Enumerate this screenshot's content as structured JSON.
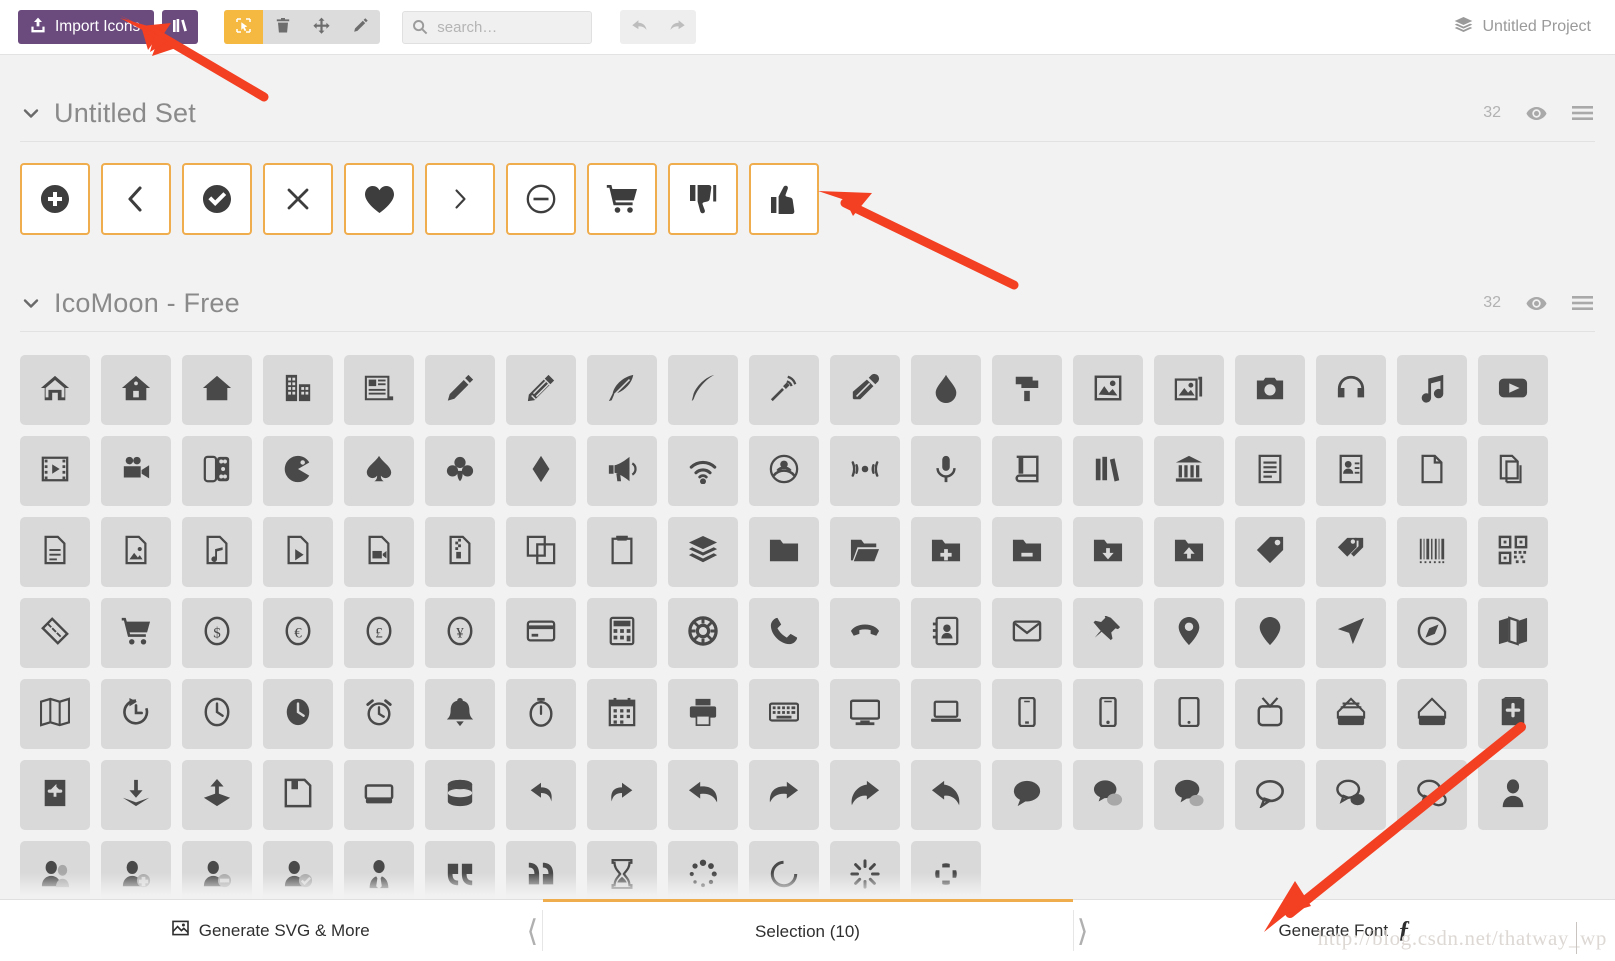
{
  "toolbar": {
    "import_label": "Import Icons",
    "import_icon": "upload-icon",
    "library_icon": "library-icon",
    "tools": [
      {
        "name": "select-tool",
        "icon": "cursor-select-icon",
        "active": true
      },
      {
        "name": "delete-tool",
        "icon": "trash-icon",
        "active": false
      },
      {
        "name": "move-tool",
        "icon": "move-arrows-icon",
        "active": false
      },
      {
        "name": "edit-tool",
        "icon": "pencil-icon",
        "active": false
      }
    ],
    "search": {
      "value": "",
      "placeholder": "search…",
      "icon": "search-icon"
    },
    "history": [
      {
        "name": "undo-button",
        "icon": "undo-arrow-icon"
      },
      {
        "name": "redo-button",
        "icon": "redo-arrow-icon"
      }
    ],
    "project": {
      "label": "Untitled Project",
      "icon": "layers-icon"
    }
  },
  "sets": [
    {
      "title": "Untitled Set",
      "count": "32",
      "caret_icon": "chevron-down-icon",
      "eye_icon": "eye-icon",
      "menu_icon": "hamburger-menu-icon"
    },
    {
      "title": "IcoMoon - Free",
      "count": "32",
      "caret_icon": "chevron-down-icon",
      "eye_icon": "eye-icon",
      "menu_icon": "hamburger-menu-icon"
    }
  ],
  "selection_icons": [
    "plus-circle-icon",
    "chevron-left-icon",
    "check-circle-icon",
    "close-x-icon",
    "heart-icon",
    "chevron-right-icon",
    "minus-circle-icon",
    "cart-icon",
    "thumbs-down-icon",
    "thumbs-up-icon"
  ],
  "library_icons": [
    "home-icon",
    "home2-icon",
    "home3-icon",
    "office-icon",
    "newspaper-icon",
    "pencil-icon",
    "pencil2-icon",
    "quill-icon",
    "pen-icon",
    "blog-icon",
    "eyedropper-icon",
    "droplet-icon",
    "paint-format-icon",
    "image-icon",
    "images-icon",
    "camera-icon",
    "headphones-icon",
    "music-icon",
    "play-icon",
    "film-icon",
    "video-camera-icon",
    "dice-icon",
    "pacman-icon",
    "spades-icon",
    "clubs-icon",
    "diamonds-icon",
    "bullhorn-icon",
    "connection-icon",
    "podcast-icon",
    "feed-icon",
    "mic-icon",
    "book-icon",
    "books-icon",
    "library-icon",
    "file-text-icon",
    "profile-icon",
    "file-empty-icon",
    "files-empty-icon",
    "file-text2-icon",
    "file-picture-icon",
    "file-music-icon",
    "file-play-icon",
    "file-video-icon",
    "file-zip-icon",
    "copy-icon",
    "paste-icon",
    "stack-icon",
    "folder-icon",
    "folder-open-icon",
    "folder-plus-icon",
    "folder-minus-icon",
    "folder-download-icon",
    "folder-upload-icon",
    "price-tag-icon",
    "price-tags-icon",
    "barcode-icon",
    "qrcode-icon",
    "ticket-icon",
    "cart-icon",
    "coin-dollar-icon",
    "coin-euro-icon",
    "coin-pound-icon",
    "coin-yen-icon",
    "credit-card-icon",
    "calculator-icon",
    "lifebuoy-icon",
    "phone-icon",
    "phone-hang-up-icon",
    "address-book-icon",
    "envelop-icon",
    "pushpin-icon",
    "location-icon",
    "location2-icon",
    "compass-icon",
    "compass2-icon",
    "map-icon",
    "map2-icon",
    "history-icon",
    "clock-icon",
    "clock2-icon",
    "alarm-icon",
    "bell-icon",
    "stopwatch-icon",
    "calendar-icon",
    "printer-icon",
    "keyboard-icon",
    "display-icon",
    "laptop-icon",
    "mobile-icon",
    "mobile2-icon",
    "tablet-icon",
    "tv-icon",
    "drawer-icon",
    "drawer2-icon",
    "box-add-icon",
    "box-remove-icon",
    "download-icon",
    "upload-icon",
    "floppy-disk-icon",
    "drive-icon",
    "database-icon",
    "undo-icon",
    "redo-icon",
    "undo2-icon",
    "redo2-icon",
    "forward-icon",
    "reply-icon",
    "bubble-icon",
    "bubbles-icon",
    "bubbles2-icon",
    "bubble2-icon",
    "bubbles3-icon",
    "bubbles4-icon",
    "user-icon",
    "users-icon",
    "user-plus-icon",
    "user-minus-icon",
    "user-check-icon",
    "user-tie-icon",
    "quotes-left-icon",
    "quotes-right-icon",
    "hour-glass-icon",
    "spinner-icon",
    "spinner2-icon",
    "spinner3-icon",
    "spinner4-icon"
  ],
  "bottom": {
    "generate_svg_label": "Generate SVG & More",
    "generate_svg_icon": "image-icon",
    "selection_label": "Selection (10)",
    "prev_icon": "chevron-left-icon",
    "next_icon": "chevron-right-icon",
    "generate_font_label": "Generate Font",
    "generate_font_icon": "font-f-icon"
  },
  "watermark": {
    "text": "http://blog.csdn.net/thatway_wp"
  },
  "annotations": [
    {
      "name": "arrow-to-import-icons",
      "color": "#f33f22"
    },
    {
      "name": "arrow-to-thumbs-up-icon",
      "color": "#f33f22"
    },
    {
      "name": "arrow-to-generate-font",
      "color": "#f33f22"
    }
  ]
}
